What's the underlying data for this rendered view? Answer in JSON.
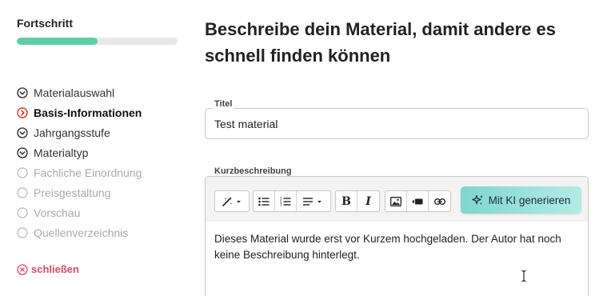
{
  "sidebar": {
    "progress_title": "Fortschritt",
    "progress_fraction": 0.5,
    "progress_color": "#5ecfa4",
    "steps": [
      {
        "label": "Materialauswahl",
        "state": "done"
      },
      {
        "label": "Basis-Informationen",
        "state": "active"
      },
      {
        "label": "Jahrgangsstufe",
        "state": "done"
      },
      {
        "label": "Materialtyp",
        "state": "done"
      },
      {
        "label": "Fachliche Einordnung",
        "state": "pending"
      },
      {
        "label": "Preisgestaltung",
        "state": "pending"
      },
      {
        "label": "Vorschau",
        "state": "pending"
      },
      {
        "label": "Quellenverzeichnis",
        "state": "pending"
      }
    ],
    "close_label": "schließen"
  },
  "main": {
    "heading": "Beschreibe dein Material, damit andere es schnell finden können",
    "title_field": {
      "label": "Titel",
      "value": "Test material"
    },
    "short_description": {
      "label": "Kurzbeschreibung",
      "ai_button_label": "Mit KI generieren",
      "text": "Dieses Material wurde erst vor Kurzem hochgeladen. Der Autor hat noch keine Beschreibung hinterlegt."
    }
  },
  "colors": {
    "accent_green": "#5ecfa4",
    "danger": "#e0476a",
    "ai_gradient_start": "#7fd6cf",
    "ai_gradient_end": "#b3ebe6"
  },
  "toolbar_icons": [
    "magic-wand-icon",
    "bullet-list-icon",
    "numbered-list-icon",
    "align-icon",
    "bold-icon",
    "italic-icon",
    "image-icon",
    "video-icon",
    "link-icon"
  ]
}
